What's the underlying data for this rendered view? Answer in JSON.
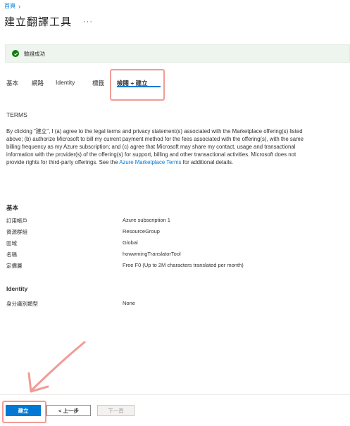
{
  "breadcrumb": {
    "home": "首頁",
    "separator": "›"
  },
  "header": {
    "title": "建立翻譯工具",
    "more": "···"
  },
  "banner": {
    "text": "驗證成功",
    "icon": "check-circle-icon",
    "color": "#107c10"
  },
  "tabs": [
    {
      "label": "基本"
    },
    {
      "label": "網路"
    },
    {
      "label": "Identity"
    },
    {
      "label": "標籤"
    },
    {
      "label": "檢閱 + 建立"
    }
  ],
  "terms": {
    "title": "TERMS",
    "body": "By clicking \"建立\", I (a) agree to the legal terms and privacy statement(s) associated with the Marketplace offering(s) listed above; (b) authorize Microsoft to bill my current payment method for the fees associated with the offering(s), with the same billing frequency as my Azure subscription; and (c) agree that Microsoft may share my contact, usage and transactional information with the provider(s) of the offering(s) for support, billing and other transactional activities. Microsoft does not provide rights for third-party offerings. See the ",
    "link": "Azure Marketplace Terms",
    "tail": " for additional details."
  },
  "basics": {
    "title": "基本",
    "rows": [
      {
        "key": "訂用帳戶",
        "value": "Azure subscription 1"
      },
      {
        "key": "資源群組",
        "value": "ResourceGroup"
      },
      {
        "key": "區域",
        "value": "Global"
      },
      {
        "key": "名稱",
        "value": "howwmingTranslatorTool"
      },
      {
        "key": "定價層",
        "value": "Free F0 (Up to 2M characters translated per month)"
      }
    ]
  },
  "identity": {
    "title": "Identity",
    "rows": [
      {
        "key": "身分識別類型",
        "value": "None"
      }
    ]
  },
  "footer": {
    "create": "建立",
    "prev": "< 上一步",
    "next": "下一頁"
  },
  "colors": {
    "accent": "#0078d4",
    "annotation": "#f29b95"
  }
}
